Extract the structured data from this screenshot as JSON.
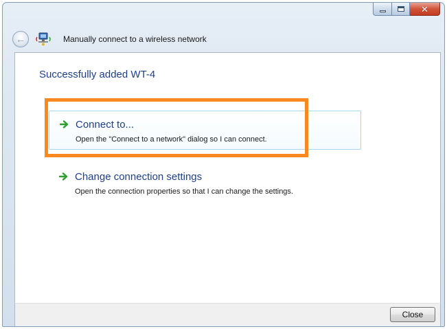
{
  "window": {
    "title": "Manually connect to a wireless network",
    "caption": {
      "minimize": "–",
      "maximize": "□",
      "close": "✕"
    }
  },
  "heading": "Successfully added WT-4",
  "options": [
    {
      "title": "Connect to...",
      "description": "Open the \"Connect to a network\" dialog so I can connect.",
      "icon": "green-arrow-icon",
      "highlighted": true
    },
    {
      "title": "Change connection settings",
      "description": "Open the connection properties so that I can change the settings.",
      "icon": "green-arrow-icon",
      "highlighted": false
    }
  ],
  "footer": {
    "close_label": "Close"
  },
  "colors": {
    "accent_text": "#1d3f8a",
    "highlight_border": "#f7891e",
    "arrow_green": "#2e9e2e"
  }
}
